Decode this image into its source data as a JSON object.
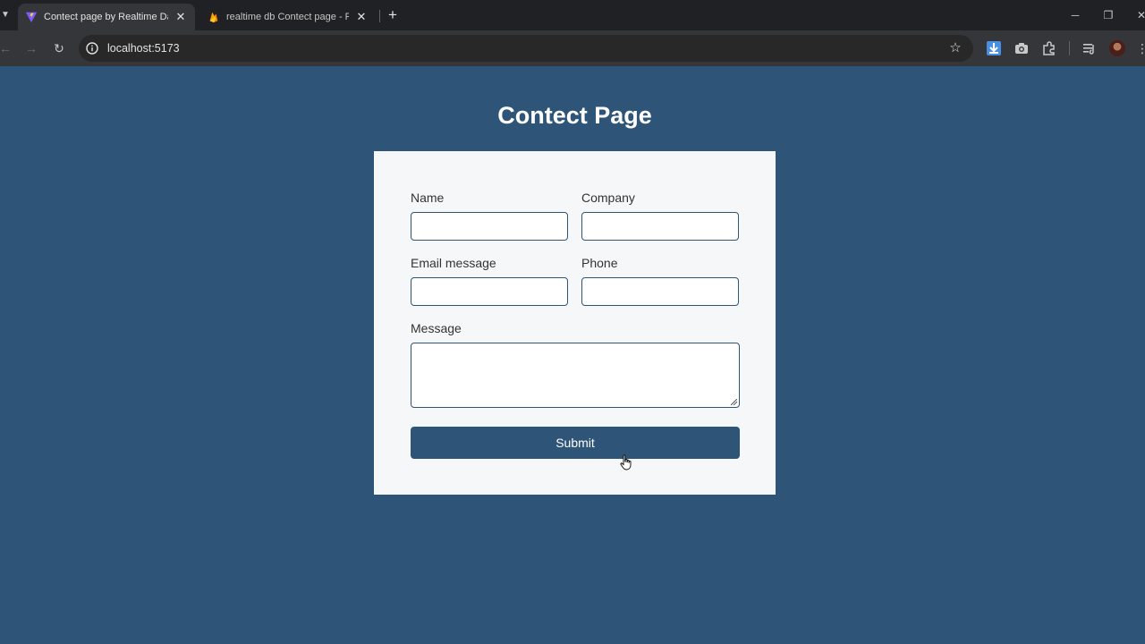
{
  "browser": {
    "tabs": [
      {
        "title": "Contect page by Realtime Datab",
        "active": true,
        "icon": "vite-icon"
      },
      {
        "title": "realtime db Contect page - Rea",
        "active": false,
        "icon": "firebase-icon"
      }
    ],
    "close_glyph": "✕",
    "new_tab_glyph": "+",
    "address": "localhost:5173"
  },
  "page": {
    "title": "Contect Page",
    "form": {
      "name_label": "Name",
      "company_label": "Company",
      "email_label": "Email message",
      "phone_label": "Phone",
      "message_label": "Message",
      "name_value": "",
      "company_value": "",
      "email_value": "",
      "phone_value": "",
      "message_value": "",
      "submit_label": "Submit"
    }
  },
  "colors": {
    "page_background": "#2e5577",
    "card_background": "#f5f7f9",
    "button_background": "#2e5577",
    "input_border": "#2e5577",
    "tabbar": "#202124",
    "toolbar": "#35363a"
  }
}
